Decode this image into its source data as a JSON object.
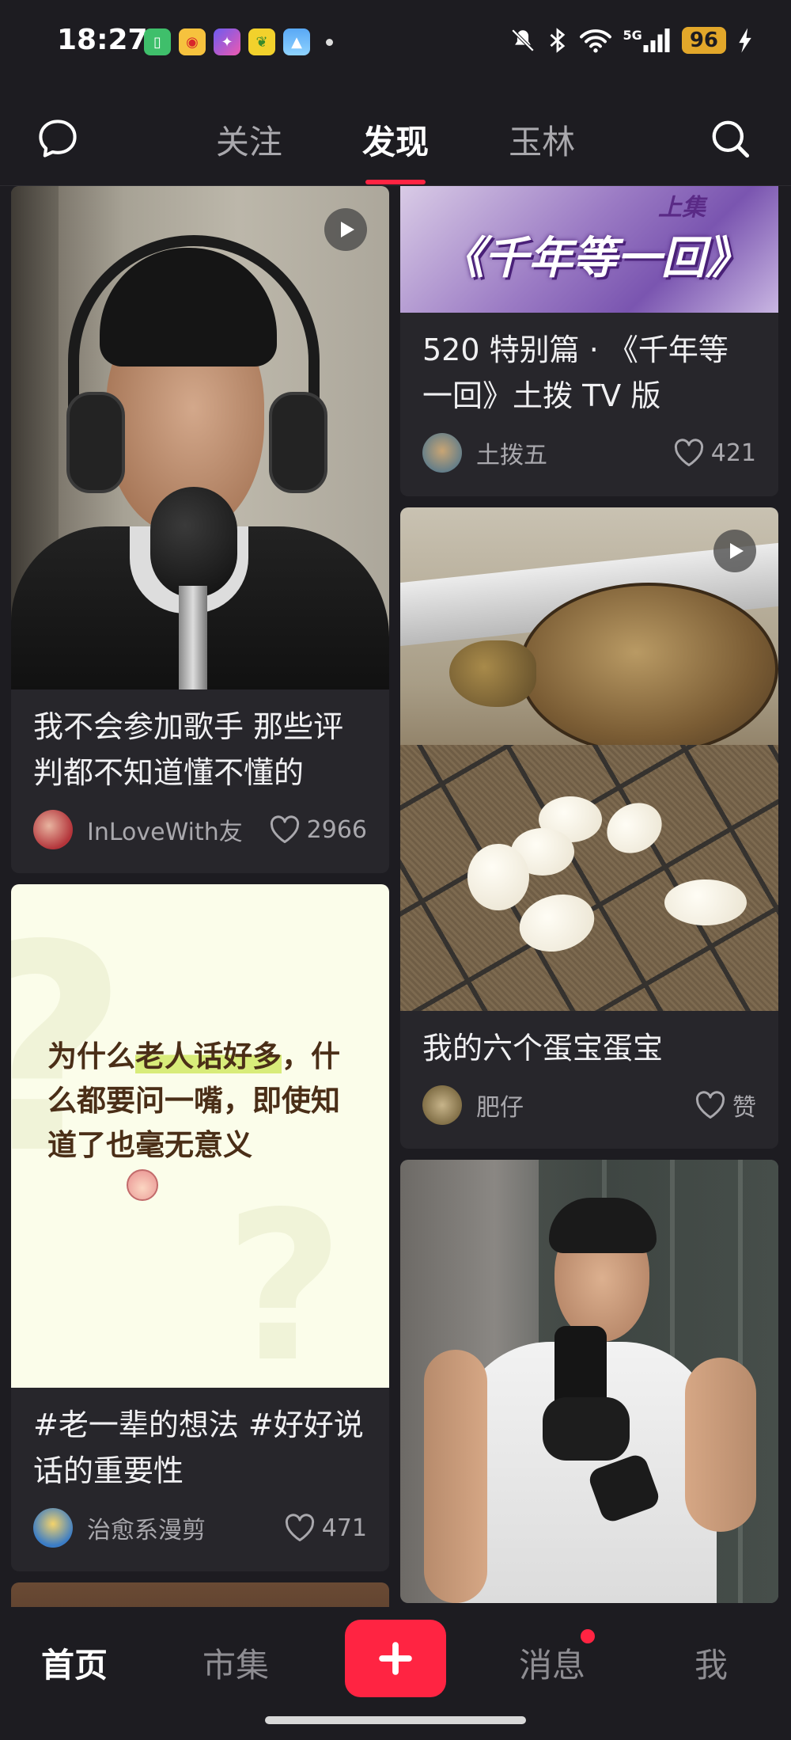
{
  "status_bar": {
    "time": "18:27",
    "battery": "96",
    "network": "5G",
    "icons": [
      "battery-saver-icon",
      "weibo-icon",
      "star-app-icon",
      "banana-app-icon",
      "gallery-icon",
      "mute-icon",
      "bluetooth-icon",
      "wifi-icon",
      "signal-icon",
      "charging-icon"
    ]
  },
  "top_nav": {
    "tabs": [
      {
        "label": "关注",
        "active": false
      },
      {
        "label": "发现",
        "active": true
      },
      {
        "label": "玉林",
        "active": false
      }
    ]
  },
  "feed": {
    "left": [
      {
        "title": "我不会参加歌手 那些评判都不知道懂不懂的",
        "author": "InLoveWith友",
        "likes": "2966",
        "is_video": true
      },
      {
        "image_text": "为什么老人话好多，什么都要问一嘴，即使知道了也毫无意义",
        "image_highlight": "老人话好多",
        "title": "#老一辈的想法 #好好说话的重要性",
        "author": "治愈系漫剪",
        "likes": "471",
        "is_video": false
      }
    ],
    "right": [
      {
        "image_text": "《千年等一回》",
        "image_badge": "上集",
        "title": "520 特别篇 · 《千年等一回》土拨 TV 版",
        "author": "土拨五",
        "likes": "421",
        "is_video": false
      },
      {
        "title": "我的六个蛋宝蛋宝",
        "author": "肥仔",
        "likes": "赞",
        "is_video": true
      },
      {
        "title": "",
        "author": "",
        "likes": "",
        "is_video": false
      }
    ]
  },
  "bottom_nav": {
    "items": [
      {
        "label": "首页",
        "active": true
      },
      {
        "label": "市集",
        "active": false
      },
      {
        "label": "消息",
        "active": false,
        "has_badge": true
      },
      {
        "label": "我",
        "active": false
      }
    ],
    "publish_icon": "plus-icon"
  },
  "colors": {
    "accent": "#ff2442",
    "background": "#1d1c21",
    "card": "#27262b"
  }
}
